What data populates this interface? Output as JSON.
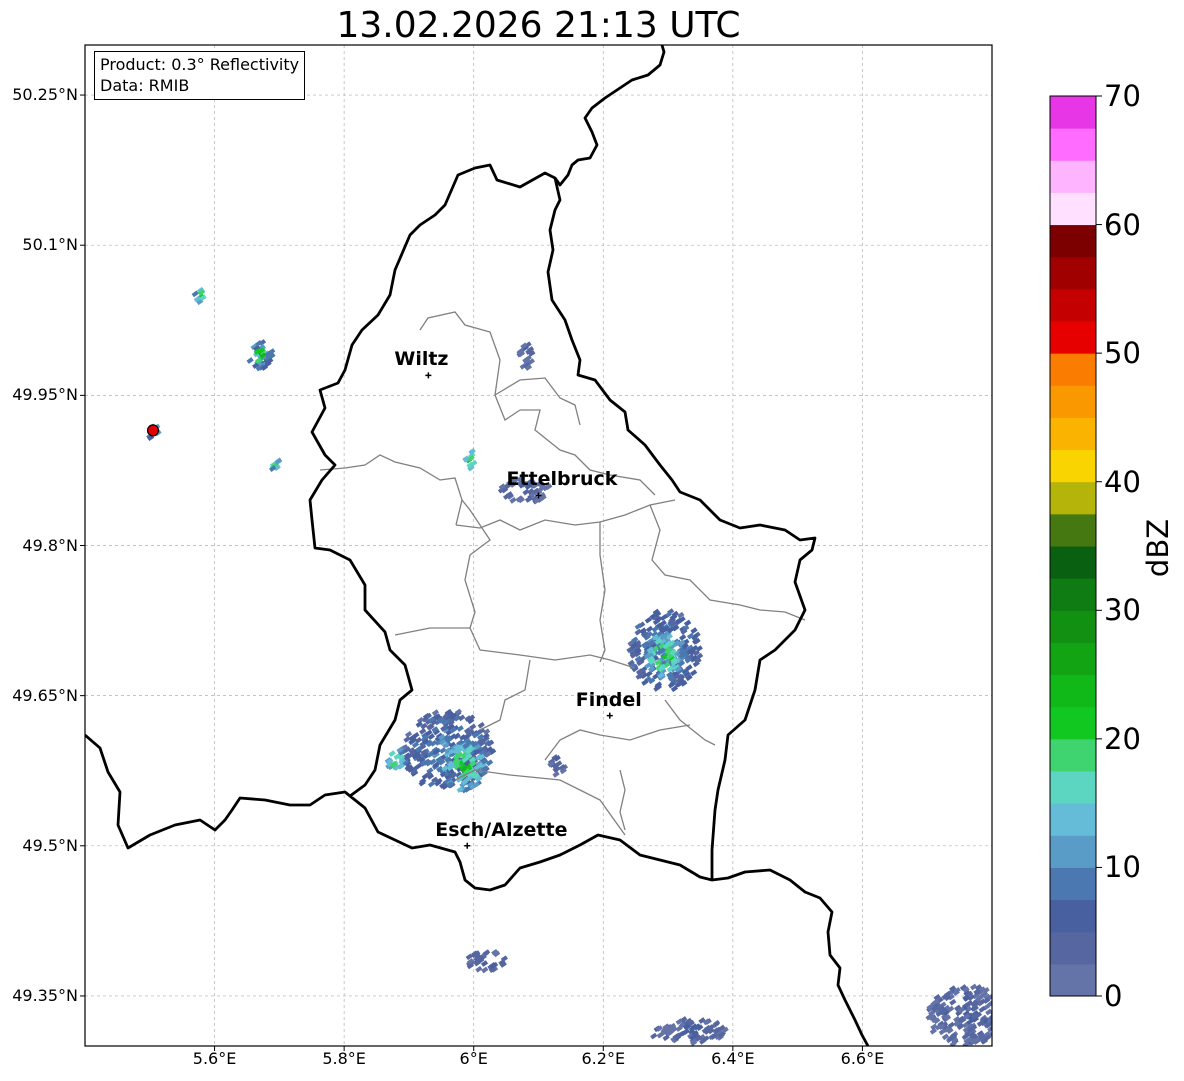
{
  "title": "13.02.2026 21:13 UTC",
  "info": {
    "product": "Product: 0.3° Reflectivity",
    "source": "Data: RMIB"
  },
  "map": {
    "lon_range": [
      5.4,
      6.8
    ],
    "lat_range": [
      49.3,
      50.3
    ],
    "lat_ticks": [
      {
        "value": 50.25,
        "label": "50.25°N"
      },
      {
        "value": 50.1,
        "label": "50.1°N"
      },
      {
        "value": 49.95,
        "label": "49.95°N"
      },
      {
        "value": 49.8,
        "label": "49.8°N"
      },
      {
        "value": 49.65,
        "label": "49.65°N"
      },
      {
        "value": 49.5,
        "label": "49.5°N"
      },
      {
        "value": 49.35,
        "label": "49.35°N"
      }
    ],
    "lon_ticks": [
      {
        "value": 5.6,
        "label": "5.6°E"
      },
      {
        "value": 5.8,
        "label": "5.8°E"
      },
      {
        "value": 6.0,
        "label": "6°E"
      },
      {
        "value": 6.2,
        "label": "6.2°E"
      },
      {
        "value": 6.4,
        "label": "6.4°E"
      },
      {
        "value": 6.6,
        "label": "6.6°E"
      }
    ],
    "cities": [
      {
        "name": "Wiltz",
        "lon": 5.93,
        "lat": 49.97
      },
      {
        "name": "Ettelbruck",
        "lon": 6.1,
        "lat": 49.85
      },
      {
        "name": "Findel",
        "lon": 6.21,
        "lat": 49.63
      },
      {
        "name": "Esch/Alzette",
        "lon": 5.99,
        "lat": 49.5
      }
    ],
    "radar_site": {
      "lon": 5.505,
      "lat": 49.915
    }
  },
  "colorbar": {
    "label": "dBZ",
    "min": 0,
    "max": 70,
    "step": 2.5,
    "ticks": [
      "0",
      "10",
      "20",
      "30",
      "40",
      "50",
      "60",
      "70"
    ],
    "colors": [
      "#6473a8",
      "#5566a0",
      "#4860a0",
      "#4b78b0",
      "#5a9cc8",
      "#64bcd8",
      "#5cd6c0",
      "#40d470",
      "#10c820",
      "#10b818",
      "#12a412",
      "#119012",
      "#0e7c12",
      "#086010",
      "#467812",
      "#b4b40a",
      "#fad400",
      "#fab400",
      "#fa9800",
      "#fa7c00",
      "#e60000",
      "#c40000",
      "#a00000",
      "#7c0000",
      "#ffe0ff",
      "#ffb4ff",
      "#ff6cff",
      "#e636e6"
    ]
  },
  "echoes": [
    {
      "lon": 5.96,
      "lat": 49.595,
      "rx": 0.07,
      "ry": 0.04,
      "dbz": 10
    },
    {
      "lon": 5.985,
      "lat": 49.58,
      "rx": 0.035,
      "ry": 0.025,
      "dbz": 22
    },
    {
      "lon": 5.88,
      "lat": 49.585,
      "rx": 0.015,
      "ry": 0.012,
      "dbz": 21
    },
    {
      "lon": 6.295,
      "lat": 49.695,
      "rx": 0.055,
      "ry": 0.04,
      "dbz": 11
    },
    {
      "lon": 6.295,
      "lat": 49.69,
      "rx": 0.028,
      "ry": 0.022,
      "dbz": 23
    },
    {
      "lon": 6.08,
      "lat": 49.855,
      "rx": 0.04,
      "ry": 0.012,
      "dbz": 4
    },
    {
      "lon": 5.995,
      "lat": 49.885,
      "rx": 0.008,
      "ry": 0.012,
      "dbz": 24
    },
    {
      "lon": 5.67,
      "lat": 49.99,
      "rx": 0.02,
      "ry": 0.014,
      "dbz": 14
    },
    {
      "lon": 5.67,
      "lat": 49.99,
      "rx": 0.006,
      "ry": 0.006,
      "dbz": 40
    },
    {
      "lon": 5.58,
      "lat": 50.05,
      "rx": 0.01,
      "ry": 0.008,
      "dbz": 22
    },
    {
      "lon": 5.505,
      "lat": 49.915,
      "rx": 0.01,
      "ry": 0.008,
      "dbz": 18
    },
    {
      "lon": 5.695,
      "lat": 49.88,
      "rx": 0.007,
      "ry": 0.006,
      "dbz": 22
    },
    {
      "lon": 6.02,
      "lat": 49.385,
      "rx": 0.03,
      "ry": 0.01,
      "dbz": 4
    },
    {
      "lon": 6.13,
      "lat": 49.58,
      "rx": 0.012,
      "ry": 0.01,
      "dbz": 5
    },
    {
      "lon": 6.08,
      "lat": 49.99,
      "rx": 0.012,
      "ry": 0.014,
      "dbz": 3
    },
    {
      "lon": 6.76,
      "lat": 49.33,
      "rx": 0.06,
      "ry": 0.03,
      "dbz": 4
    },
    {
      "lon": 6.33,
      "lat": 49.315,
      "rx": 0.06,
      "ry": 0.012,
      "dbz": 4
    }
  ]
}
